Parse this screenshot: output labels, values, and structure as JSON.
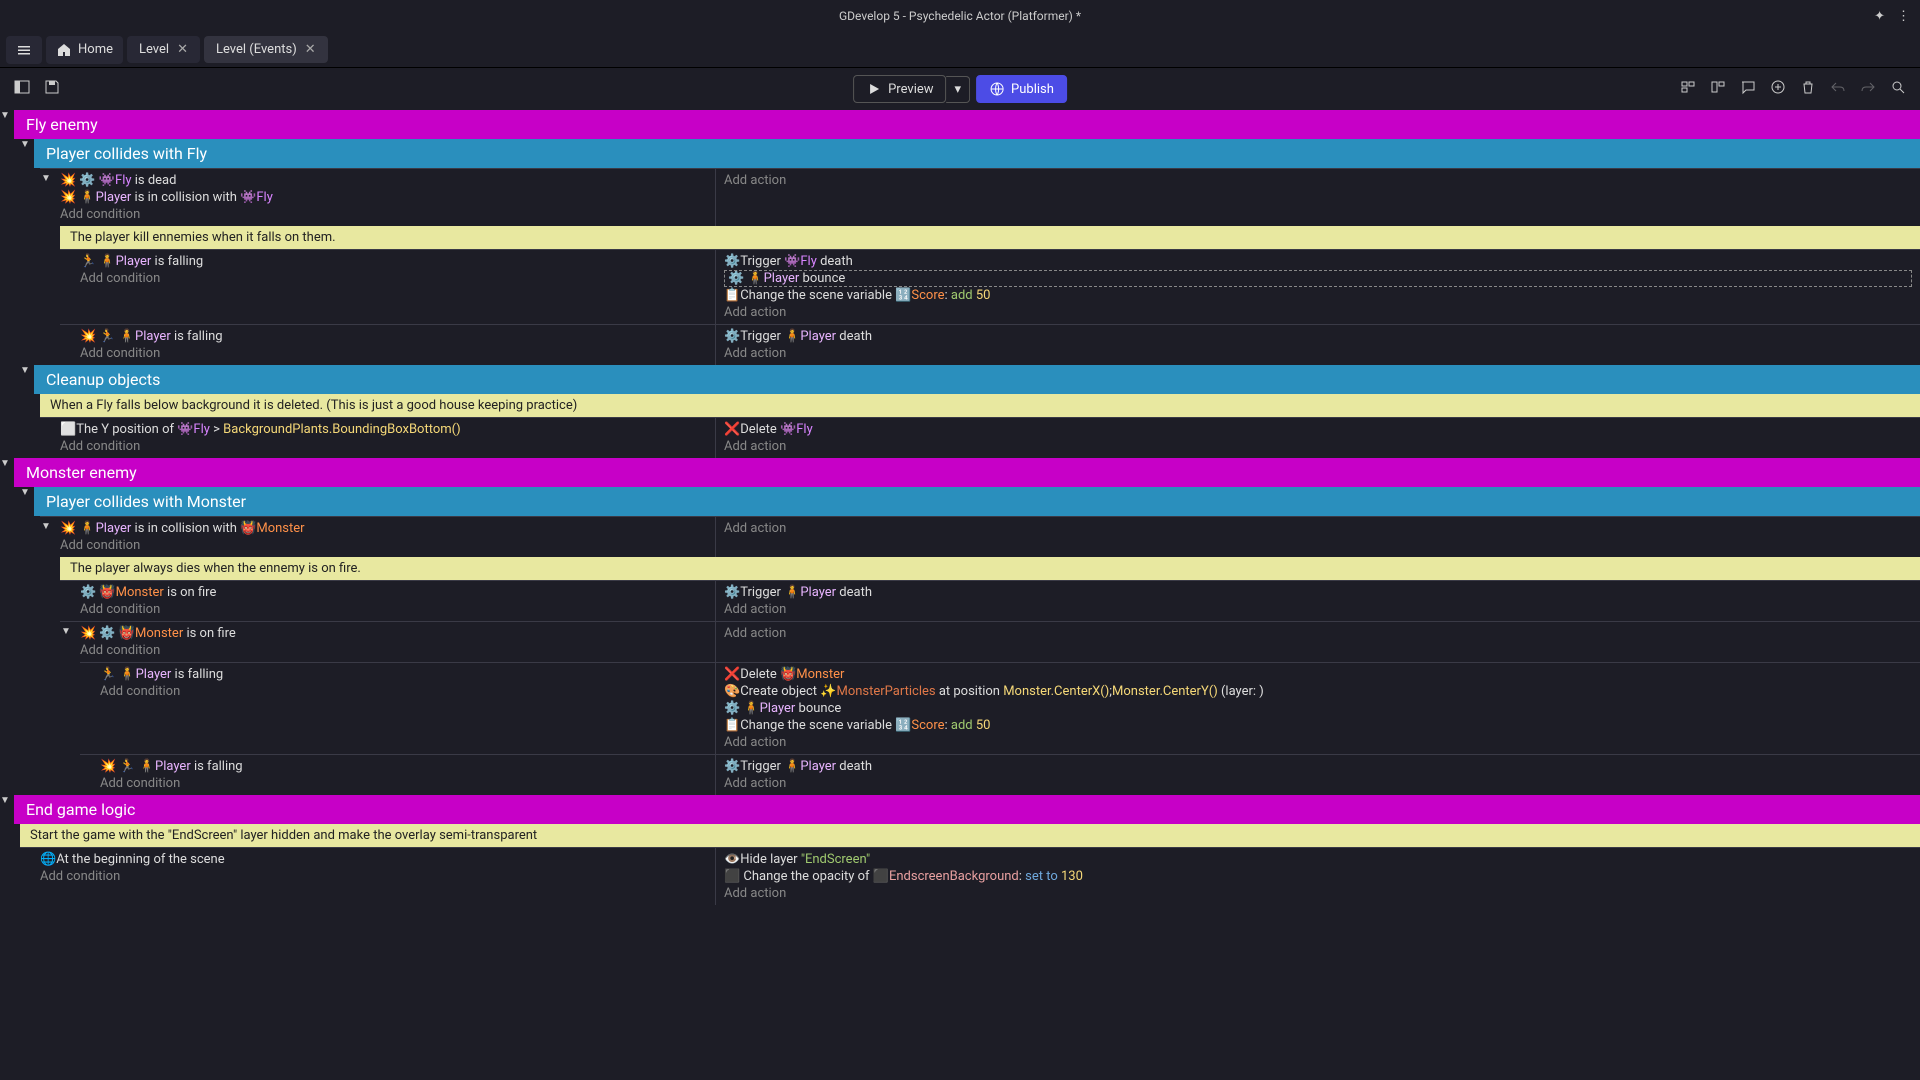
{
  "window": {
    "title": "GDevelop 5 - Psychedelic Actor (Platformer) *"
  },
  "tabs": {
    "home": "Home",
    "level": "Level",
    "level_events": "Level (Events)"
  },
  "toolbar": {
    "preview": "Preview",
    "publish": "Publish"
  },
  "txt": {
    "fly_enemy": "Fly enemy",
    "player_collides_fly": "Player collides with Fly",
    "cleanup_objects": "Cleanup objects",
    "monster_enemy": "Monster enemy",
    "player_collides_monster": "Player collides with Monster",
    "end_game_logic": "End game logic",
    "add_condition": "Add condition",
    "add_action": "Add action",
    "is_dead": " is dead",
    "is_in_collision_with": " is in collision with ",
    "is_falling": " is falling",
    "is_on_fire": " is on fire",
    "trigger": "Trigger ",
    "death": " death",
    "bounce": " bounce",
    "change_scene_var": "Change the scene variable ",
    "colon_add": ": ",
    "fifty": "50",
    "comment_kill": "The player kill ennemies when it falls on them.",
    "comment_cleanup": "When a Fly falls below background it is deleted. (This is just a good house keeping practice)",
    "comment_fire": "The player always dies when the ennemy is on fire.",
    "comment_endgame": "Start the game with the \"EndScreen\" layer hidden and make the overlay semi-transparent",
    "y_position_of": "The Y position of ",
    "gt": " > ",
    "bg_expr": "BackgroundPlants.BoundingBoxBottom()",
    "delete": "Delete ",
    "create_object": "Create object ",
    "at_position": " at position ",
    "pos_x": "Monster.CenterX()",
    "semi": ";",
    "pos_y": "Monster.CenterY()",
    "layer_suffix": " (layer:  )",
    "at_begin": "At the beginning of the scene",
    "hide_layer": "Hide layer ",
    "endscreen": "\"EndScreen\"",
    "change_opacity": "Change the opacity of ",
    "endscreen_bg": "EndscreenBackground",
    "set_to": "set to",
    "v130": "130",
    "fly": "Fly",
    "player": "Player",
    "monster": "Monster",
    "monster_particles": "MonsterParticles",
    "score": "Score",
    "add_kw": "add"
  }
}
